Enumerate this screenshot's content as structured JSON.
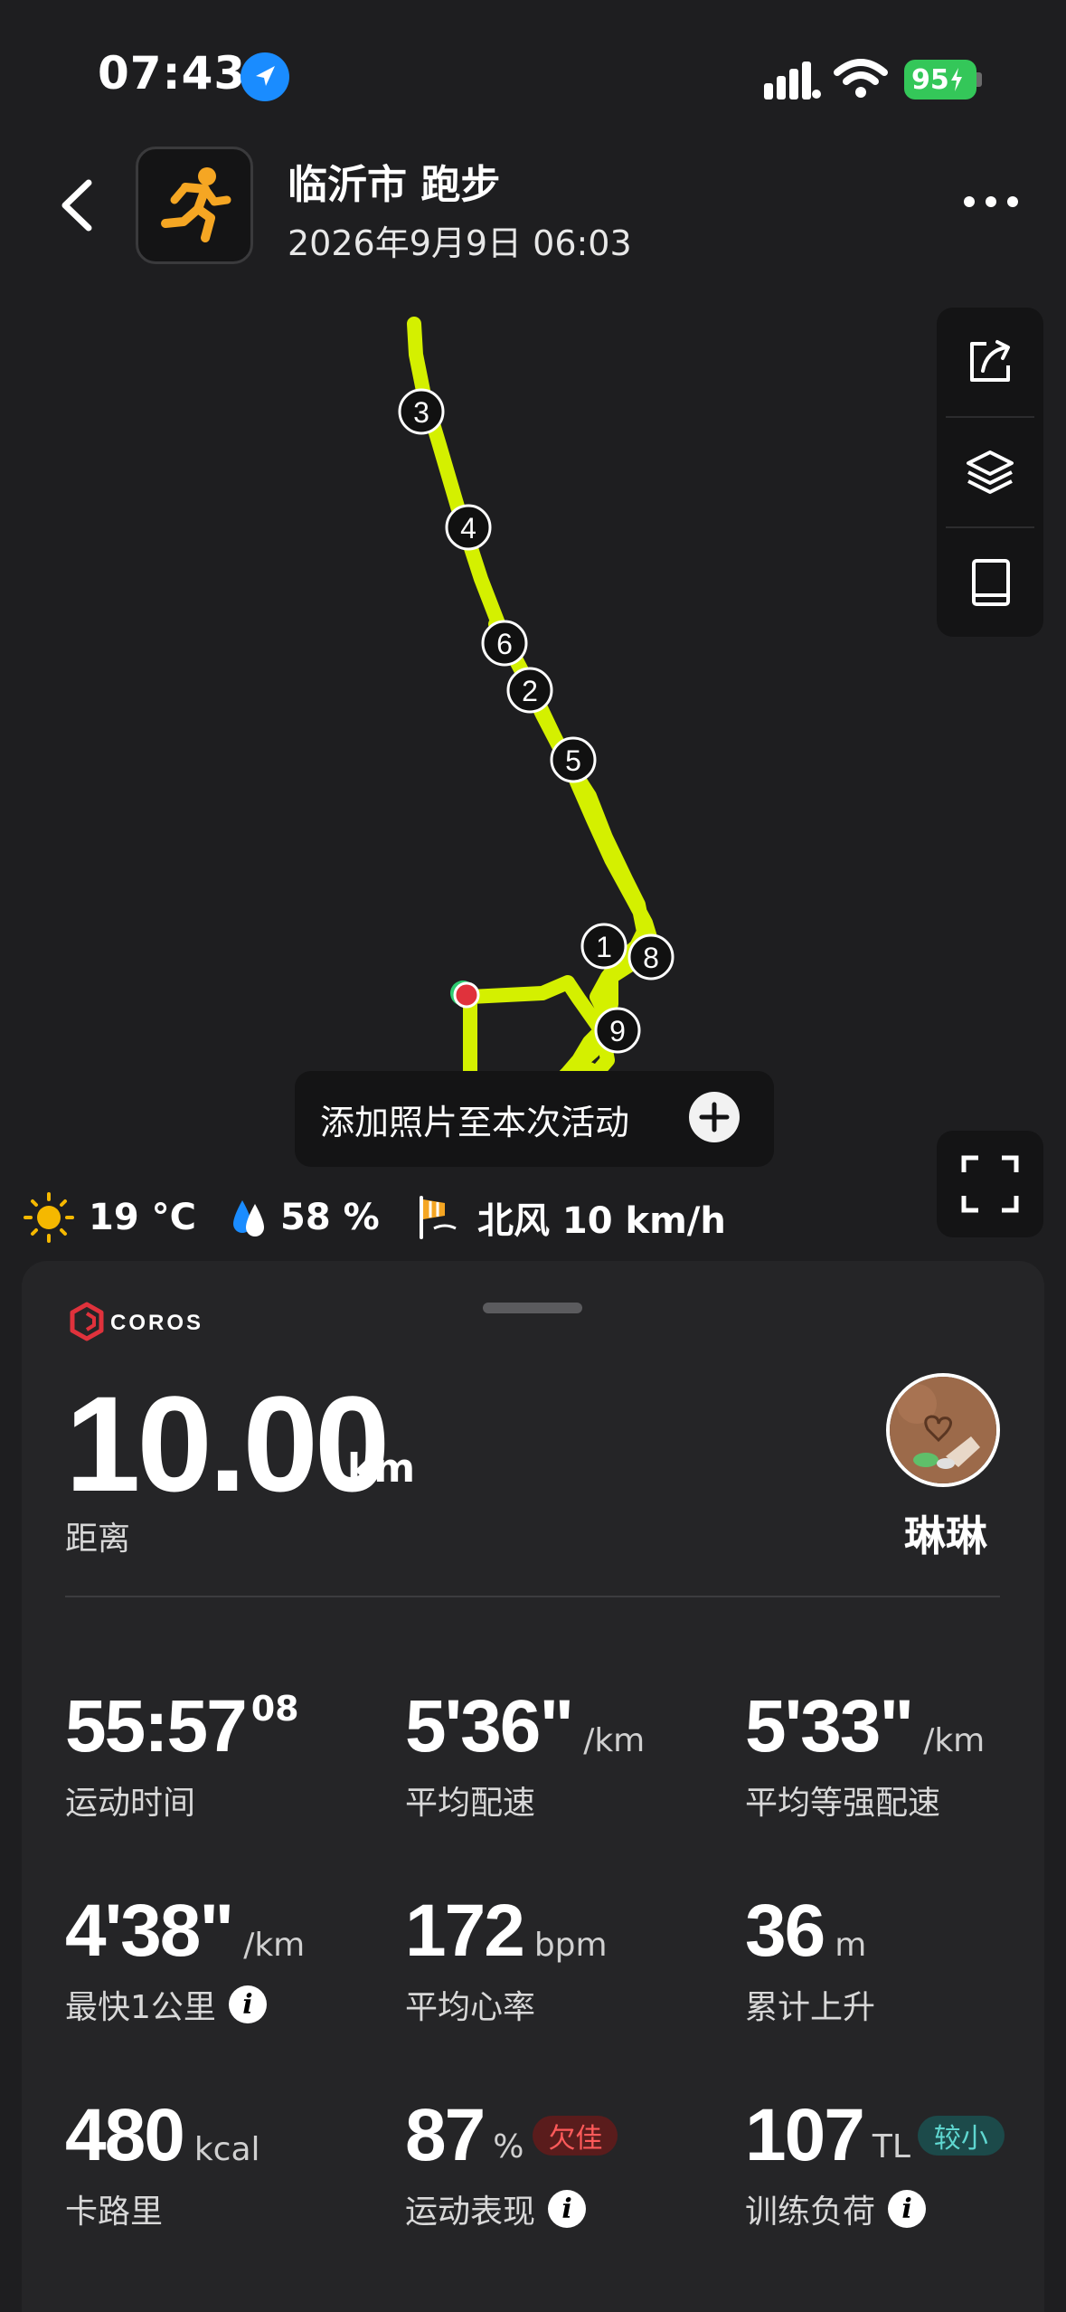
{
  "status_bar": {
    "time": "07:43",
    "battery": "95"
  },
  "header": {
    "title": "临沂市 跑步",
    "datetime": "2026年9月9日 06:03"
  },
  "map": {
    "route_color": "#d4f000",
    "markers": [
      "3",
      "4",
      "6",
      "2",
      "5",
      "1",
      "8",
      "9"
    ],
    "add_photo_label": "添加照片至本次活动",
    "tools": [
      "share-icon",
      "layers-icon",
      "book-icon"
    ]
  },
  "weather": {
    "temperature": "19 °C",
    "humidity": "58 %",
    "wind": "北风 10 km/h"
  },
  "summary": {
    "brand": "COROS",
    "distance": "10.00",
    "distance_unit": "km",
    "distance_label": "距离",
    "user_name": "琳琳"
  },
  "stats": [
    {
      "value": "55:57",
      "sup": "08",
      "unit": "",
      "label": "运动时间"
    },
    {
      "value": "5'36\"",
      "sup": "",
      "unit": "/km",
      "label": "平均配速"
    },
    {
      "value": "5'33\"",
      "sup": "",
      "unit": "/km",
      "label": "平均等强配速"
    },
    {
      "value": "4'38\"",
      "sup": "",
      "unit": "/km",
      "label": "最快1公里"
    },
    {
      "value": "172",
      "sup": "",
      "unit": "bpm",
      "label": "平均心率"
    },
    {
      "value": "36",
      "sup": "",
      "unit": "m",
      "label": "累计上升"
    },
    {
      "value": "480",
      "sup": "",
      "unit": "kcal",
      "label": "卡路里"
    },
    {
      "value": "87",
      "sup": "",
      "unit": "%",
      "label": "运动表现",
      "badge": "欠佳"
    },
    {
      "value": "107",
      "sup": "",
      "unit": "TL",
      "label": "训练负荷",
      "badge": "较小"
    }
  ],
  "colors": {
    "accent_green": "#d4f000",
    "runner_orange": "#f5a623",
    "coros_red": "#e0323c"
  }
}
